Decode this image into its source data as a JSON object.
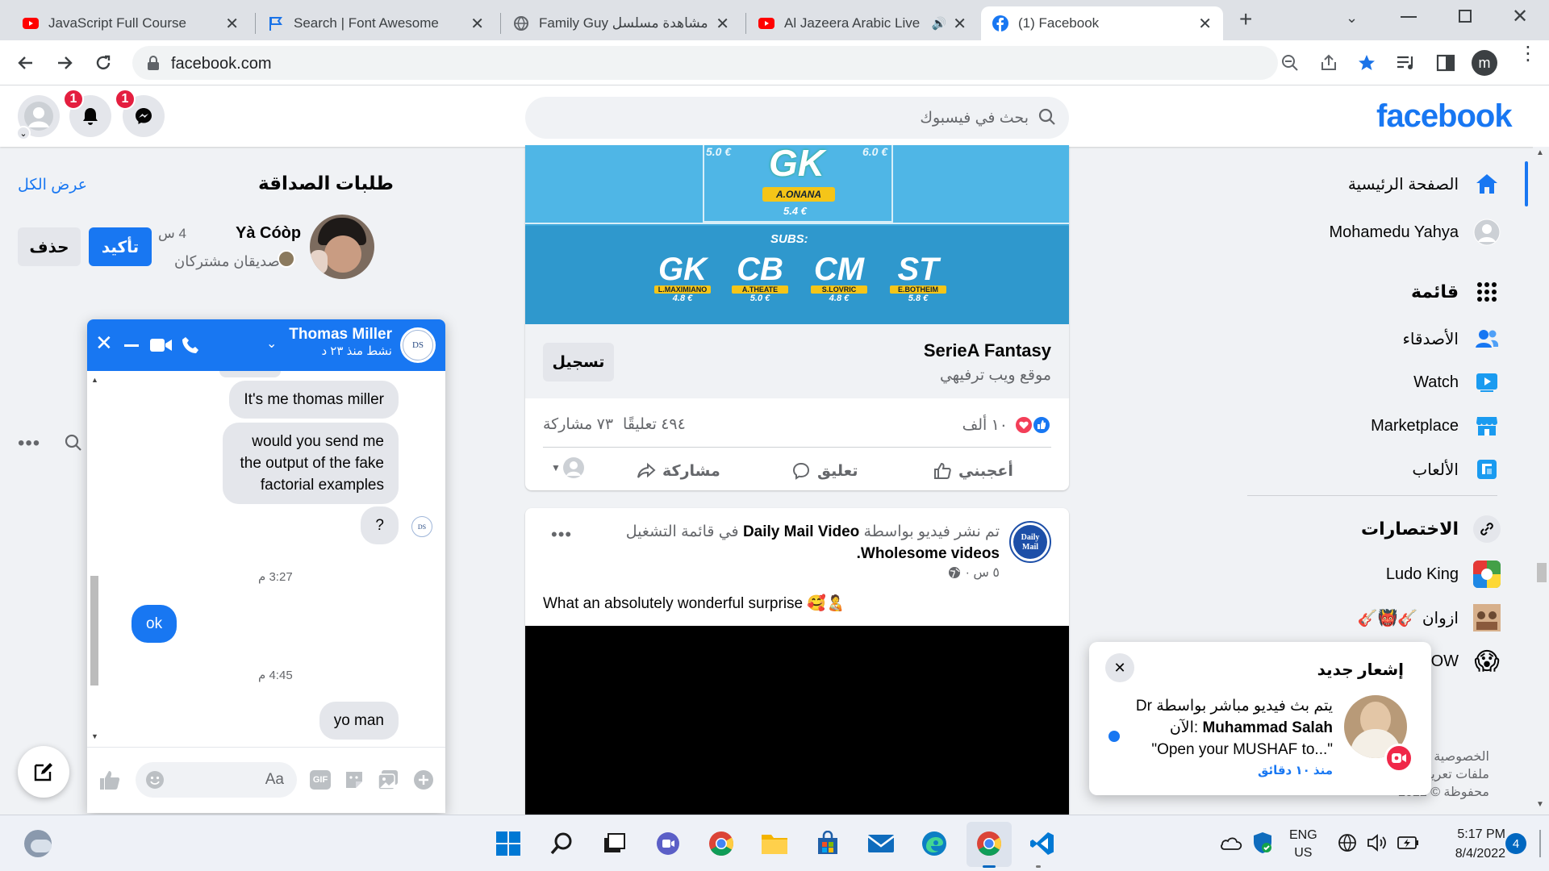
{
  "browser": {
    "tabs": [
      {
        "title": "JavaScript Full Course",
        "active": false
      },
      {
        "title": "Search | Font Awesome",
        "active": false
      },
      {
        "title": "مشاهدة مسلسل Family Guy",
        "active": false
      },
      {
        "title": "Al Jazeera Arabic Live",
        "active": false
      },
      {
        "title": "(1) Facebook",
        "active": true
      }
    ],
    "url": "facebook.com",
    "profile_initial": "m"
  },
  "header": {
    "logo": "facebook",
    "search_placeholder": "بحث في فيسبوك",
    "notifications_badge": "1",
    "messenger_badge": "1"
  },
  "friend_requests": {
    "title": "طلبات الصداقة",
    "see_all": "عرض الكل",
    "request": {
      "name": "Yà Cóòp",
      "time": "4 س",
      "mutual": "صديقان مشتركان",
      "confirm": "تأكيد",
      "delete": "حذف"
    }
  },
  "nav": {
    "items": [
      {
        "label": "الصفحة الرئيسية",
        "icon": "home-icon"
      },
      {
        "label": "Mohamedu Yahya",
        "icon": "profile-icon"
      },
      {
        "label": "قائمة",
        "icon": "menu-grid-icon"
      },
      {
        "label": "الأصدقاء",
        "icon": "friends-icon"
      },
      {
        "label": "Watch",
        "icon": "watch-icon"
      },
      {
        "label": "Marketplace",
        "icon": "marketplace-icon"
      },
      {
        "label": "الألعاب",
        "icon": "gaming-icon"
      }
    ],
    "shortcuts_title": "الاختصارات",
    "shortcuts": [
      {
        "label": "Ludo King"
      },
      {
        "label": "ازوان 🎸👹🎸"
      },
      {
        "label": "OW"
      }
    ],
    "footer_1": "الخصوصية",
    "footer_2": "ملفات تعريف",
    "footer_3": "محفوظة © 2022"
  },
  "ad_post": {
    "field_labels": {
      "gk": "GK",
      "gk_name": "A.ONANA",
      "gk_price": "5.4 €",
      "top_left_price": "5.0 €",
      "top_right_price": "6.0 €",
      "subs": "SUBS:",
      "sub1": "GK",
      "sub1_name": "L.MAXIMIANO",
      "sub1_price": "4.8 €",
      "sub2": "CB",
      "sub2_name": "A.THEATE",
      "sub2_price": "5.0 €",
      "sub3": "CM",
      "sub3_name": "S.LOVRIC",
      "sub3_price": "4.8 €",
      "sub4": "ST",
      "sub4_name": "E.BOTHEIM",
      "sub4_price": "5.8 €"
    },
    "title": "SerieA Fantasy",
    "subtitle": "موقع ويب ترفيهي",
    "cta": "تسجيل",
    "reactions": "١٠ ألف",
    "comments": "٤٩٤ تعليقًا",
    "shares": "٧٣ مشاركة",
    "like": "أعجبني",
    "comment": "تعليق",
    "share": "مشاركة"
  },
  "video_post": {
    "line1_prefix": "تم نشر فيديو بواسطة",
    "page": "Daily Mail Video",
    "line1_suffix": "في قائمة التشغيل",
    "playlist": "Wholesome videos.",
    "time": "٥ س ·",
    "text": "What an absolutely wonderful surprise 🥰🧑‍🍼",
    "avatar_text": "Daily Mail"
  },
  "chat": {
    "name": "Thomas Miller",
    "status": "نشط منذ ٢٣ د",
    "avatar": "DS",
    "messages": [
      {
        "text": "It's me thomas miller",
        "side": "in"
      },
      {
        "text": "would you send me the output of the fake factorial examples",
        "side": "in"
      },
      {
        "text": "?",
        "side": "in"
      },
      {
        "time": "3:27 م"
      },
      {
        "text": "ok",
        "side": "out"
      },
      {
        "time": "4:45 م"
      },
      {
        "text": "yo man",
        "side": "in"
      }
    ],
    "input_placeholder": "Aa",
    "gif": "GIF"
  },
  "notification": {
    "title": "إشعار جديد",
    "line1": "يتم بث فيديو مباشر بواسطة Dr",
    "line2_name": "Muhammad Salah",
    "line2_suffix": "الآن:",
    "line3": "\"Open your MUSHAF to...\"",
    "time": "منذ ١٠ دقائق"
  },
  "taskbar": {
    "lang1": "ENG",
    "lang2": "US",
    "time": "5:17 PM",
    "date": "8/4/2022",
    "notif_count": "4"
  },
  "colors": {
    "brand": "#1877f2",
    "badge": "#e41e3f"
  }
}
